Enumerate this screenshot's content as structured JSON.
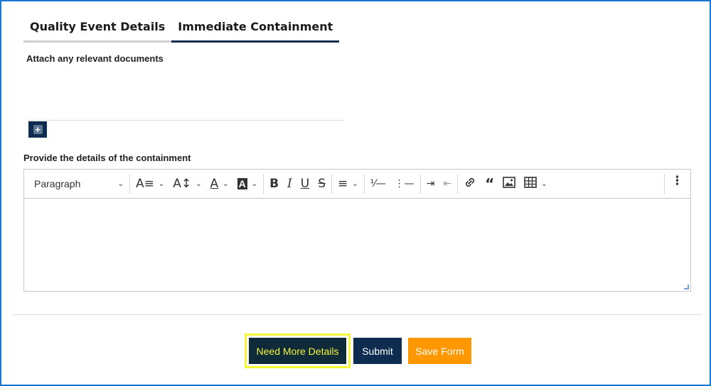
{
  "tabs": [
    {
      "label": "Quality Event Details",
      "active": false
    },
    {
      "label": "Immediate Containment",
      "active": true
    }
  ],
  "attach": {
    "label": "Attach any relevant documents",
    "add_icon": "plus-icon"
  },
  "containment": {
    "label": "Provide the details of the containment",
    "paragraph_select": "Paragraph",
    "editor_value": ""
  },
  "toolbar_icons": [
    "font-size-icon",
    "line-height-icon",
    "font-color-icon",
    "highlight-icon",
    "bold-icon",
    "italic-icon",
    "underline-icon",
    "strikethrough-icon",
    "align-icon",
    "numbered-list-icon",
    "bulleted-list-icon",
    "indent-icon",
    "outdent-icon",
    "link-icon",
    "blockquote-icon",
    "image-icon",
    "table-icon",
    "more-icon"
  ],
  "buttons": {
    "need_more": "Need More Details",
    "submit": "Submit",
    "save": "Save Form"
  },
  "colors": {
    "primary": "#0d2c4f",
    "highlight": "#f5f53a",
    "save": "#ff9800",
    "frame": "#1976d2"
  }
}
